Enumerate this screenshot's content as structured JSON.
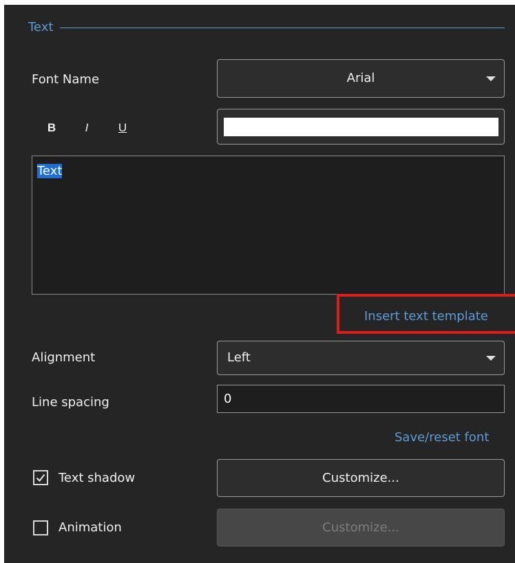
{
  "group": {
    "title": "Text"
  },
  "font": {
    "label": "Font Name",
    "selected": "Arial"
  },
  "style": {
    "bold": "B",
    "italic": "I",
    "underline": "U"
  },
  "color": {
    "value": "#ffffff"
  },
  "text_area": {
    "content": "Text"
  },
  "links": {
    "insert_template": "Insert text template",
    "save_reset_font": "Save/reset font"
  },
  "alignment": {
    "label": "Alignment",
    "selected": "Left"
  },
  "line_spacing": {
    "label": "Line spacing",
    "value": "0"
  },
  "text_shadow": {
    "label": "Text shadow",
    "checked": true,
    "button_label": "Customize..."
  },
  "animation": {
    "label": "Animation",
    "checked": false,
    "button_label": "Customize..."
  },
  "colors": {
    "panel_bg": "#252525",
    "accent_link": "#5d9cd6",
    "highlight": "#e11a1a",
    "selection": "#1e6fd0"
  }
}
